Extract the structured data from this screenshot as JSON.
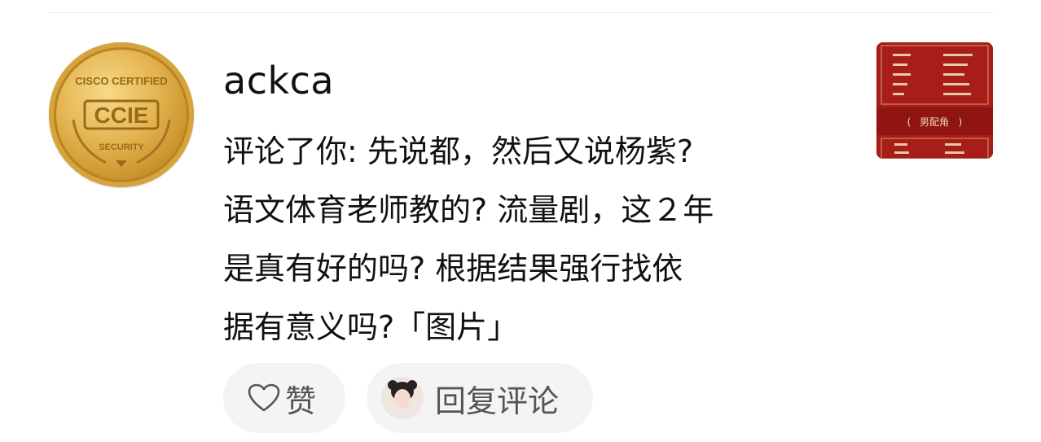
{
  "comment": {
    "username": "ackca",
    "text_lines": [
      "评论了你: 先说都，然后又说杨紫?",
      "语文体育老师教的? 流量剧，这２年",
      "是真有好的吗? 根据结果强行找依",
      "据有意义吗?「图片」"
    ]
  },
  "avatar": {
    "badge_top": "CISCO CERTIFIED",
    "badge_main": "CCIE",
    "badge_bottom": "SECURITY"
  },
  "thumbnail": {
    "heading": "男配角"
  },
  "actions": {
    "like_label": "赞",
    "reply_label": "回复评论"
  },
  "colors": {
    "thumbnail_bg": "#a81c1a",
    "button_bg": "#f4f4f4"
  }
}
